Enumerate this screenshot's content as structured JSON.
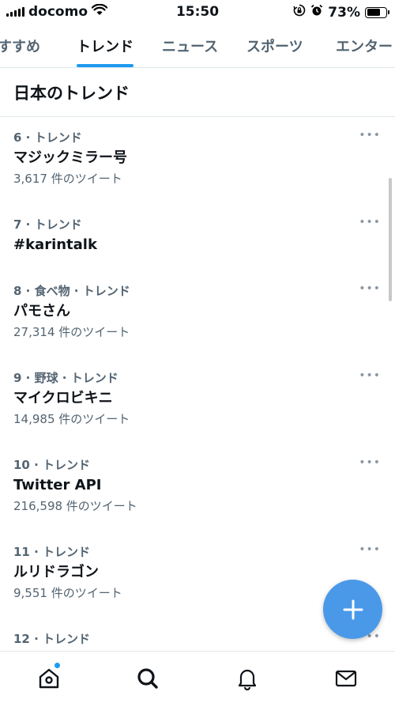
{
  "status_bar": {
    "carrier": "docomo",
    "time": "15:50",
    "battery_percent": "73%",
    "battery_level": 0.73,
    "icons": [
      "signal-icon",
      "wifi-icon",
      "orientation-lock-icon",
      "alarm-icon",
      "battery-icon"
    ]
  },
  "tabs": [
    {
      "label": "すすめ",
      "active": false
    },
    {
      "label": "トレンド",
      "active": true
    },
    {
      "label": "ニュース",
      "active": false
    },
    {
      "label": "スポーツ",
      "active": false
    },
    {
      "label": "エンター",
      "active": false
    }
  ],
  "section_title": "日本のトレンド",
  "trends": [
    {
      "meta": "6 · トレンド",
      "name": "マジックミラー号",
      "count": "3,617 件のツイート"
    },
    {
      "meta": "7 · トレンド",
      "name": "#karintalk",
      "count": ""
    },
    {
      "meta": "8 · 食べ物 · トレンド",
      "name": "パモさん",
      "count": "27,314 件のツイート"
    },
    {
      "meta": "9 · 野球 · トレンド",
      "name": "マイクロビキニ",
      "count": "14,985 件のツイート"
    },
    {
      "meta": "10 · トレンド",
      "name": "Twitter API",
      "count": "216,598 件のツイート"
    },
    {
      "meta": "11 · トレンド",
      "name": "ルリドラゴン",
      "count": "9,551 件のツイート"
    },
    {
      "meta": "12 · トレンド",
      "name": "",
      "count": ""
    }
  ],
  "more_label": "•••",
  "fab": {
    "label": "+",
    "icon": "plus-icon"
  },
  "bottom_nav": [
    {
      "icon": "home-icon",
      "has_badge": true
    },
    {
      "icon": "search-icon",
      "has_badge": false
    },
    {
      "icon": "bell-icon",
      "has_badge": false
    },
    {
      "icon": "mail-icon",
      "has_badge": false
    }
  ],
  "colors": {
    "accent": "#1d9bf0",
    "fab": "#4a99e9",
    "text_primary": "#0f1419",
    "text_secondary": "#536471",
    "divider": "#e1e8ed"
  }
}
